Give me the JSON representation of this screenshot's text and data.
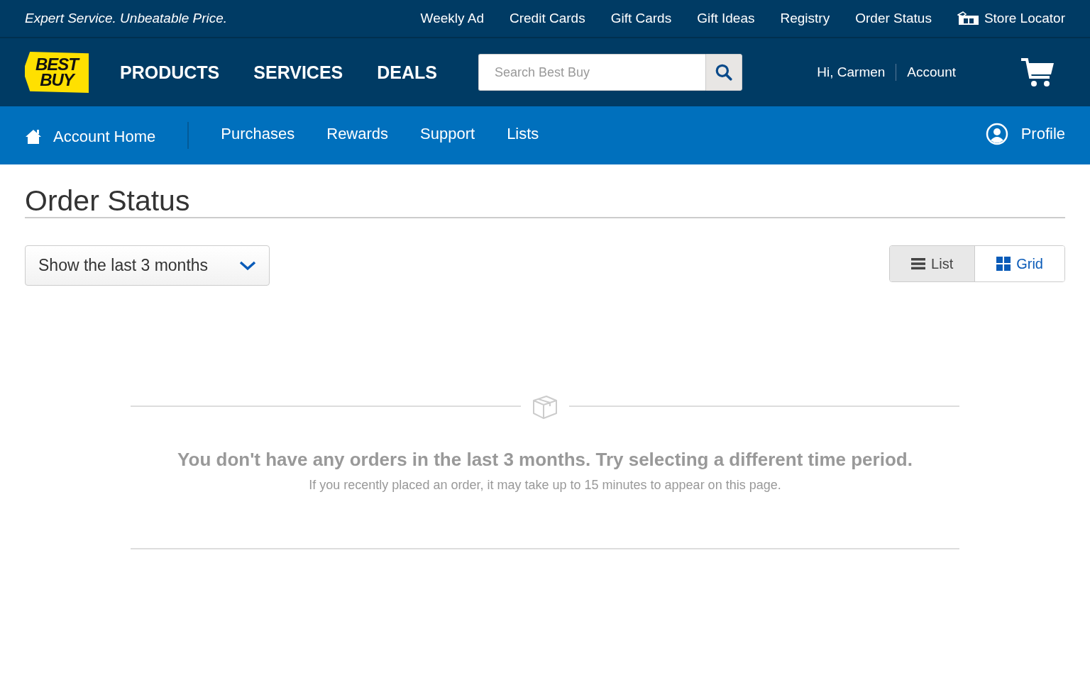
{
  "top_bar": {
    "tagline": "Expert Service. Unbeatable Price.",
    "links": [
      {
        "label": "Weekly Ad",
        "kind": "text"
      },
      {
        "label": "Credit Cards",
        "kind": "text"
      },
      {
        "label": "Gift Cards",
        "kind": "text"
      },
      {
        "label": "Gift Ideas",
        "kind": "text"
      },
      {
        "label": "Registry",
        "kind": "text"
      },
      {
        "label": "Order Status",
        "kind": "text"
      },
      {
        "label": "Store Locator",
        "kind": "store"
      }
    ]
  },
  "header": {
    "logo": [
      "BEST",
      "BUY"
    ],
    "nav": [
      "PRODUCTS",
      "SERVICES",
      "DEALS"
    ],
    "search": {
      "placeholder": "Search Best Buy"
    },
    "greeting": "Hi, Carmen",
    "account": "Account"
  },
  "account_nav": {
    "home": "Account Home",
    "items": [
      "Purchases",
      "Rewards",
      "Support",
      "Lists"
    ],
    "profile": "Profile"
  },
  "page": {
    "title": "Order Status",
    "filter": "Show the last 3 months",
    "views": [
      {
        "label": "List",
        "kind": "list",
        "selected": true
      },
      {
        "label": "Grid",
        "kind": "grid",
        "selected": false
      }
    ],
    "empty": {
      "message": "You don't have any orders in the last 3 months. Try selecting a different time period.",
      "note": "If you recently placed an order, it may take up to 15 minutes to appear on this page."
    }
  }
}
